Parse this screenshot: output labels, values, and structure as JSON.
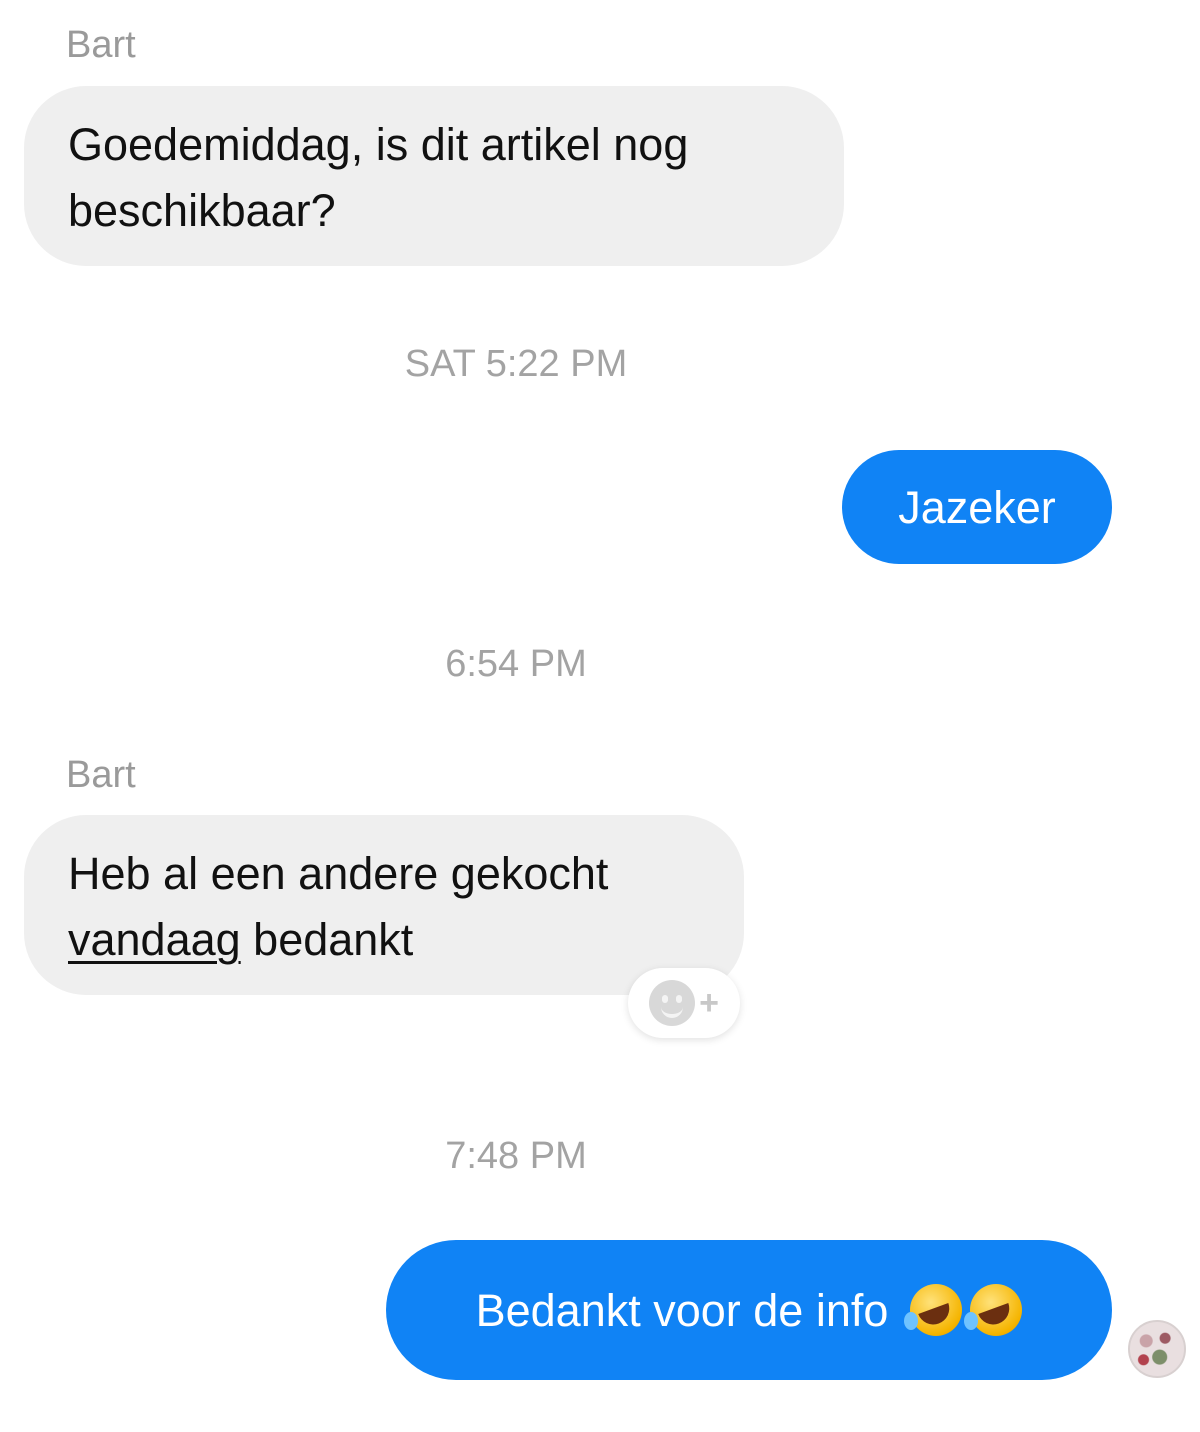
{
  "messages": [
    {
      "sender": "Bart",
      "text": "Goedemiddag, is dit artikel nog beschikbaar?"
    },
    {
      "timestamp": "SAT 5:22 PM"
    },
    {
      "text": "Jazeker"
    },
    {
      "timestamp": "6:54 PM"
    },
    {
      "sender": "Bart",
      "text_line1": "Heb al een andere gekocht",
      "text_underlined": "vandaag",
      "text_rest": " bedankt"
    },
    {
      "timestamp": "7:48 PM"
    },
    {
      "text": "Bedankt voor de info",
      "emojis": [
        "rolling-on-floor-laughing-emoji",
        "rolling-on-floor-laughing-emoji"
      ]
    }
  ],
  "colors": {
    "outgoing_bubble": "#1083f5",
    "incoming_bubble": "#efefef",
    "timestamp": "#a3a3a3"
  },
  "icons": {
    "reaction": "add-reaction-icon",
    "avatar": "seen-avatar"
  }
}
